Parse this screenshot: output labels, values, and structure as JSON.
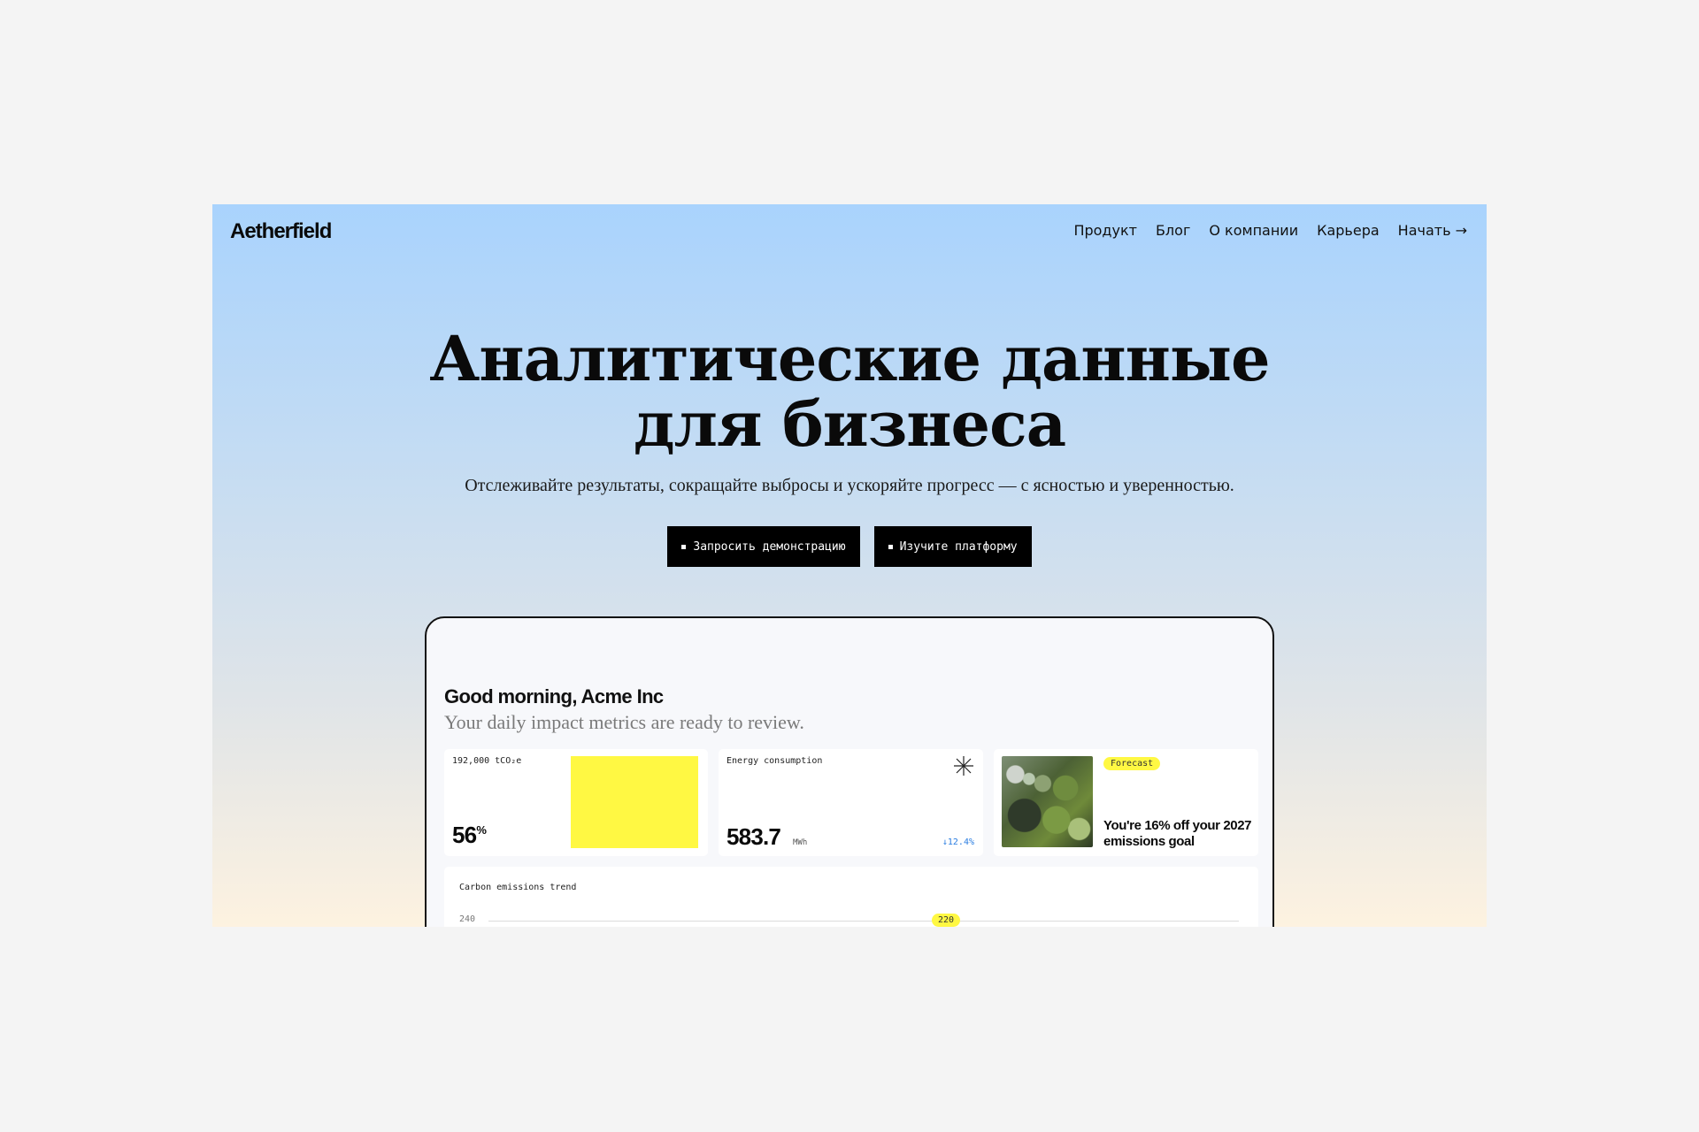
{
  "brand": {
    "logo": "Aetherfield"
  },
  "nav": {
    "items": [
      "Продукт",
      "Блог",
      "О компании",
      "Карьера",
      "Начать →"
    ]
  },
  "hero": {
    "title": "Аналитические данные\nдля бизнеса",
    "subtitle": "Отслеживайте результаты, сокращайте выбросы и ускоряйте прогресс — с ясностью и уверенностью.",
    "cta_demo": "Запросить демонстрацию",
    "cta_platform": "Изучите платформу"
  },
  "dashboard": {
    "greeting": "Good morning, Acme Inc",
    "greeting_sub": "Your daily impact metrics are ready to review.",
    "emissions_card": {
      "label": "192,000 tCO₂e",
      "value": "56",
      "value_suffix": "%",
      "accent": "#fff843"
    },
    "energy_card": {
      "label": "Energy consumption",
      "value": "583.7",
      "unit": "MWh",
      "delta": "↓12.4%",
      "icon": "sparkle-icon"
    },
    "forecast_card": {
      "badge": "Forecast",
      "text": "You're 16% off your 2027 emissions goal",
      "image": "forest-aerial-image"
    },
    "trend": {
      "title": "Carbon emissions trend",
      "y_tick": "240",
      "highlight": "220"
    }
  },
  "colors": {
    "accent_yellow": "#fff843",
    "delta_blue": "#2a7de1",
    "text_dark": "#0a0a0a"
  }
}
